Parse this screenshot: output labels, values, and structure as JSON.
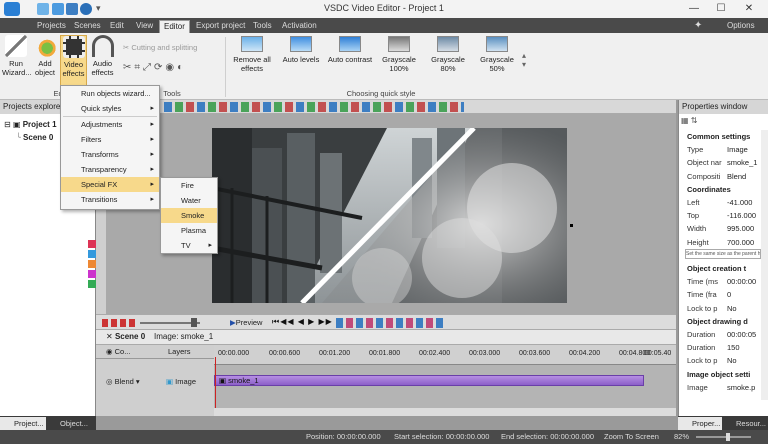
{
  "window": {
    "title": "VSDC Video Editor - Project 1",
    "options_label": "Options"
  },
  "menu_tabs": [
    "Projects",
    "Scenes",
    "Edit",
    "View",
    "Editor",
    "Export project",
    "Tools",
    "Activation"
  ],
  "ribbon": {
    "run_wizard": "Run\nWizard...",
    "add_object": "Add\nobject",
    "video_effects": "Video\neffects",
    "audio_effects": "Audio\neffects",
    "cutting_splitting": "Cutting and splitting",
    "group_edit": "Edit",
    "group_tools": "Tools",
    "group_quick_style": "Choosing quick style",
    "quick_styles": [
      "Remove all effects",
      "Auto levels",
      "Auto contrast",
      "Grayscale 100%",
      "Grayscale 80%",
      "Grayscale 50%"
    ]
  },
  "left_panel": {
    "title": "Projects explorer",
    "project": "Project 1",
    "scene": "Scene 0"
  },
  "context_menu": {
    "items": [
      "Run objects wizard...",
      "Quick styles",
      "Adjustments",
      "Filters",
      "Transforms",
      "Transparency",
      "Special FX",
      "Transitions"
    ],
    "submenu": [
      "Fire",
      "Water",
      "Smoke",
      "Plasma",
      "TV"
    ]
  },
  "timeline": {
    "preview_label": "Preview",
    "tab_scene": "Scene 0",
    "tab_image": "Image: smoke_1",
    "col_co": "Co...",
    "col_layers": "Layers",
    "row_blend": "Blend",
    "row_image": "Image",
    "clip_name": "smoke_1",
    "ruler": [
      "00:00.000",
      "00:00.600",
      "00:01.200",
      "00:01.800",
      "00:02.400",
      "00:03.000",
      "00:03.600",
      "00:04.200",
      "00:04.800",
      "00:05.40"
    ]
  },
  "properties": {
    "title": "Properties window",
    "rows": [
      {
        "type": "sec",
        "label": "Common settings"
      },
      {
        "k": "Type",
        "v": "Image"
      },
      {
        "k": "Object nar",
        "v": "smoke_1"
      },
      {
        "k": "Compositi",
        "v": "Blend"
      },
      {
        "type": "sec",
        "label": "Coordinates"
      },
      {
        "k": "Left",
        "v": "-41.000"
      },
      {
        "k": "Top",
        "v": "-116.000"
      },
      {
        "k": "Width",
        "v": "995.000"
      },
      {
        "k": "Height",
        "v": "700.000"
      },
      {
        "type": "note",
        "label": "Set the same size as the parent has"
      },
      {
        "type": "sec",
        "label": "Object creation t"
      },
      {
        "k": "Time (ms",
        "v": "00:00:00"
      },
      {
        "k": "Time (fra",
        "v": "0"
      },
      {
        "k": "Lock to p",
        "v": "No"
      },
      {
        "type": "sec",
        "label": "Object drawing d"
      },
      {
        "k": "Duration",
        "v": "00:00:05"
      },
      {
        "k": "Duration",
        "v": "150"
      },
      {
        "k": "Lock to p",
        "v": "No"
      },
      {
        "type": "sec",
        "label": "Image object setti"
      },
      {
        "k": "Image",
        "v": "smoke.p"
      }
    ]
  },
  "bottom_tabs_left": [
    "Project...",
    "Object..."
  ],
  "bottom_tabs_right": [
    "Proper...",
    "Resour..."
  ],
  "status": {
    "position": "Position:   00:00:00.000",
    "start_sel": "Start selection:   00:00:00.000",
    "end_sel": "End selection:   00:00:00.000",
    "zoom_label": "Zoom To Screen",
    "zoom_value": "82%"
  }
}
